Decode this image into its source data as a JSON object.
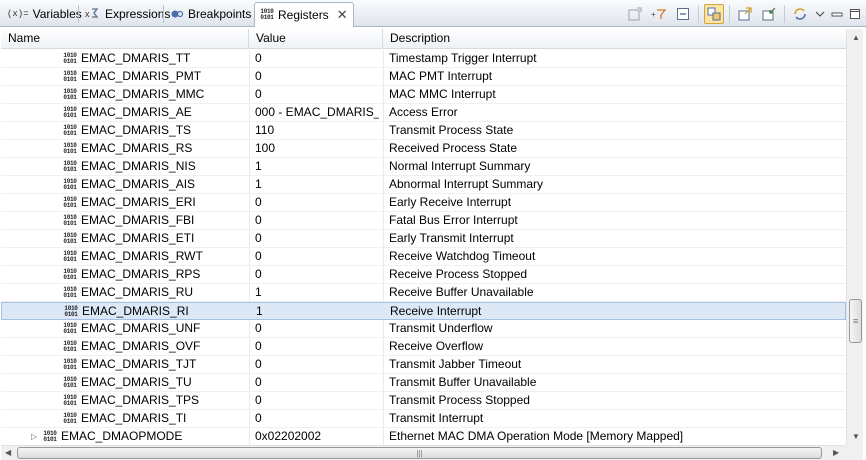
{
  "tabs": [
    {
      "label": "Variables",
      "icon": "(x)="
    },
    {
      "label": "Expressions",
      "icon": "expressions-icon"
    },
    {
      "label": "Breakpoints",
      "icon": "breakpoints-icon"
    },
    {
      "label": "Registers",
      "icon": "registers-icon",
      "active": true
    }
  ],
  "toolbar": [
    "new-register-group-icon",
    "filter-icon",
    "collapse-all-icon",
    "link-icon",
    "export-icon",
    "import-icon",
    "refresh-icon",
    "view-menu-icon"
  ],
  "table": {
    "headers": [
      "Name",
      "Value",
      "Description"
    ],
    "rows": [
      {
        "name": "EMAC_DMARIS_TT",
        "value": "0",
        "desc": "Timestamp Trigger Interrupt"
      },
      {
        "name": "EMAC_DMARIS_PMT",
        "value": "0",
        "desc": "MAC PMT Interrupt"
      },
      {
        "name": "EMAC_DMARIS_MMC",
        "value": "0",
        "desc": "MAC MMC Interrupt"
      },
      {
        "name": "EMAC_DMARIS_AE",
        "value": "000 - EMAC_DMARIS_...",
        "desc": "Access Error"
      },
      {
        "name": "EMAC_DMARIS_TS",
        "value": "110",
        "desc": "Transmit Process State"
      },
      {
        "name": "EMAC_DMARIS_RS",
        "value": "100",
        "desc": "Received Process State"
      },
      {
        "name": "EMAC_DMARIS_NIS",
        "value": "1",
        "desc": "Normal Interrupt Summary"
      },
      {
        "name": "EMAC_DMARIS_AIS",
        "value": "1",
        "desc": "Abnormal Interrupt Summary"
      },
      {
        "name": "EMAC_DMARIS_ERI",
        "value": "0",
        "desc": "Early Receive Interrupt"
      },
      {
        "name": "EMAC_DMARIS_FBI",
        "value": "0",
        "desc": "Fatal Bus Error Interrupt"
      },
      {
        "name": "EMAC_DMARIS_ETI",
        "value": "0",
        "desc": "Early Transmit Interrupt"
      },
      {
        "name": "EMAC_DMARIS_RWT",
        "value": "0",
        "desc": "Receive Watchdog Timeout"
      },
      {
        "name": "EMAC_DMARIS_RPS",
        "value": "0",
        "desc": "Receive Process Stopped"
      },
      {
        "name": "EMAC_DMARIS_RU",
        "value": "1",
        "desc": "Receive Buffer Unavailable"
      },
      {
        "name": "EMAC_DMARIS_RI",
        "value": "1",
        "desc": "Receive Interrupt",
        "selected": true
      },
      {
        "name": "EMAC_DMARIS_UNF",
        "value": "0",
        "desc": "Transmit Underflow"
      },
      {
        "name": "EMAC_DMARIS_OVF",
        "value": "0",
        "desc": "Receive Overflow"
      },
      {
        "name": "EMAC_DMARIS_TJT",
        "value": "0",
        "desc": "Transmit Jabber Timeout"
      },
      {
        "name": "EMAC_DMARIS_TU",
        "value": "0",
        "desc": "Transmit Buffer Unavailable"
      },
      {
        "name": "EMAC_DMARIS_TPS",
        "value": "0",
        "desc": "Transmit Process Stopped"
      },
      {
        "name": "EMAC_DMARIS_TI",
        "value": "0",
        "desc": "Transmit Interrupt"
      },
      {
        "name": "EMAC_DMAOPMODE",
        "value": "0x02202002",
        "desc": "Ethernet MAC DMA Operation Mode [Memory Mapped]",
        "expandable": true
      }
    ]
  },
  "colors": {
    "selection": "#dde8f7",
    "selection_border": "#a5c0e5"
  }
}
